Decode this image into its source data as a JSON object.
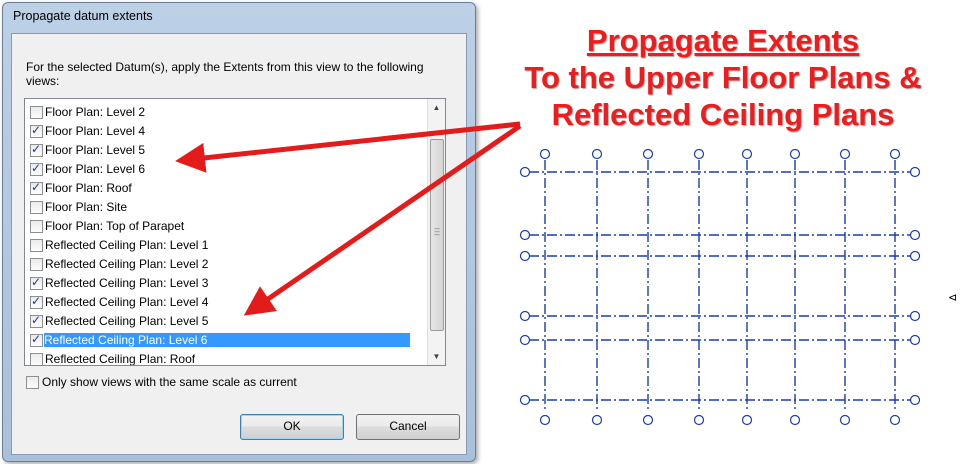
{
  "dialog": {
    "title": "Propagate datum extents",
    "description": "For the selected Datum(s), apply the Extents from this view to the following views:",
    "views": [
      {
        "label": "Floor Plan: Level 2",
        "checked": false,
        "selected": false
      },
      {
        "label": "Floor Plan: Level 4",
        "checked": true,
        "selected": false
      },
      {
        "label": "Floor Plan: Level 5",
        "checked": true,
        "selected": false
      },
      {
        "label": "Floor Plan: Level 6",
        "checked": true,
        "selected": false
      },
      {
        "label": "Floor Plan: Roof",
        "checked": true,
        "selected": false
      },
      {
        "label": "Floor Plan: Site",
        "checked": false,
        "selected": false
      },
      {
        "label": "Floor Plan: Top of Parapet",
        "checked": false,
        "selected": false
      },
      {
        "label": "Reflected Ceiling Plan: Level 1",
        "checked": false,
        "selected": false
      },
      {
        "label": "Reflected Ceiling Plan: Level 2",
        "checked": false,
        "selected": false
      },
      {
        "label": "Reflected Ceiling Plan: Level 3",
        "checked": true,
        "selected": false
      },
      {
        "label": "Reflected Ceiling Plan: Level 4",
        "checked": true,
        "selected": false
      },
      {
        "label": "Reflected Ceiling Plan: Level 5",
        "checked": true,
        "selected": false
      },
      {
        "label": "Reflected Ceiling Plan: Level 6",
        "checked": true,
        "selected": true
      },
      {
        "label": "Reflected Ceiling Plan: Roof",
        "checked": false,
        "selected": false
      }
    ],
    "same_scale_label": "Only show views with the same scale as current",
    "same_scale_checked": false,
    "ok_label": "OK",
    "cancel_label": "Cancel"
  },
  "callout": {
    "line1": "Propagate Extents",
    "line2": "To the Upper Floor Plans &",
    "line3": "Reflected Ceiling Plans",
    "color": "#ee1c1c"
  },
  "colors": {
    "grid_lines": "#1a3bb0",
    "selection": "#3399ff"
  },
  "icons": {
    "scroll_up": "scroll-up-arrow-icon",
    "scroll_down": "scroll-down-arrow-icon",
    "side": "view-tag-icon"
  }
}
